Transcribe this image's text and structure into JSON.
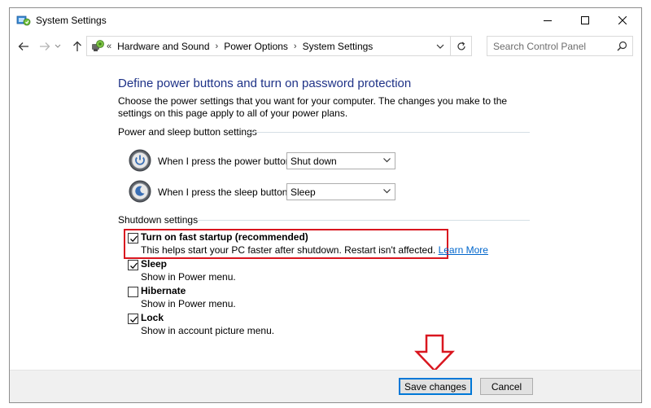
{
  "window": {
    "title": "System Settings"
  },
  "address": {
    "prefix": "«",
    "crumbs": [
      "Hardware and Sound",
      "Power Options",
      "System Settings"
    ],
    "separator": "›"
  },
  "search": {
    "placeholder": "Search Control Panel"
  },
  "page": {
    "heading": "Define power buttons and turn on password protection",
    "description": "Choose the power settings that you want for your computer. The changes you make to the settings on this page apply to all of your power plans."
  },
  "power_group": {
    "label": "Power and sleep button settings",
    "rows": [
      {
        "label": "When I press the power button:",
        "value": "Shut down"
      },
      {
        "label": "When I press the sleep button:",
        "value": "Sleep"
      }
    ]
  },
  "shutdown_group": {
    "label": "Shutdown settings",
    "options": [
      {
        "title": "Turn on fast startup (recommended)",
        "desc": "This helps start your PC faster after shutdown. Restart isn't affected. ",
        "link": "Learn More",
        "checked": true
      },
      {
        "title": "Sleep",
        "desc": "Show in Power menu.",
        "checked": true
      },
      {
        "title": "Hibernate",
        "desc": "Show in Power menu.",
        "checked": false
      },
      {
        "title": "Lock",
        "desc": "Show in account picture menu.",
        "checked": true
      }
    ]
  },
  "footer": {
    "save_label": "Save changes",
    "cancel_label": "Cancel"
  },
  "colors": {
    "heading": "#1e3287",
    "highlight_box": "#d9161f",
    "link": "#0066cc",
    "primary_button_border": "#0078d7"
  }
}
